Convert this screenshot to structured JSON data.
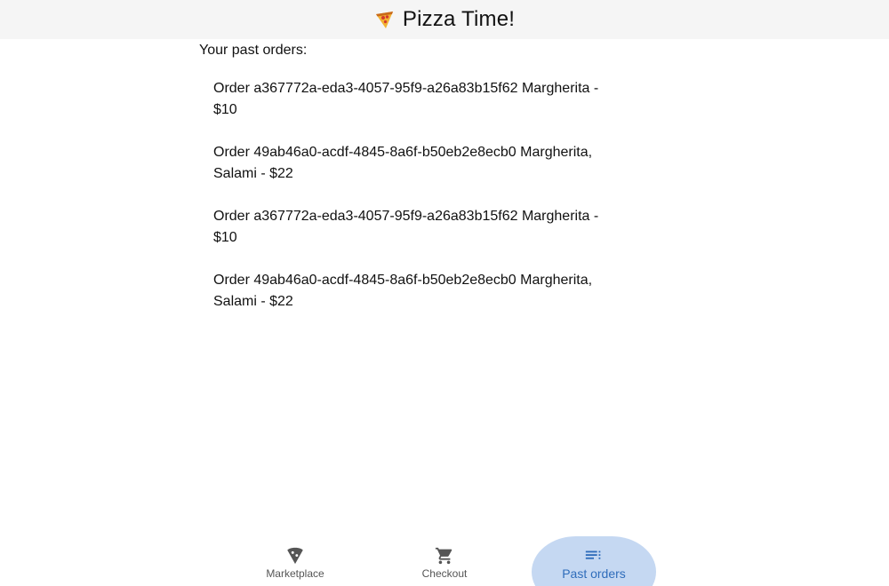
{
  "header": {
    "title": "Pizza Time!",
    "logo_icon": "pizza-slice-icon"
  },
  "main": {
    "section_title": "Your past orders:",
    "orders": [
      {
        "text": "Order a367772a-eda3-4057-95f9-a26a83b15f62 Margherita - $10"
      },
      {
        "text": "Order 49ab46a0-acdf-4845-8a6f-b50eb2e8ecb0 Margherita, Salami - $22"
      },
      {
        "text": "Order a367772a-eda3-4057-95f9-a26a83b15f62 Margherita - $10"
      },
      {
        "text": "Order 49ab46a0-acdf-4845-8a6f-b50eb2e8ecb0 Margherita, Salami - $22"
      }
    ]
  },
  "bottom_nav": {
    "items": [
      {
        "label": "Marketplace",
        "icon": "pizza-slice-icon",
        "active": false
      },
      {
        "label": "Checkout",
        "icon": "shopping-cart-icon",
        "active": false
      },
      {
        "label": "Past orders",
        "icon": "list-icon",
        "active": true
      }
    ],
    "active_color": "#2f6dbb",
    "active_background": "#c5d8f2"
  }
}
